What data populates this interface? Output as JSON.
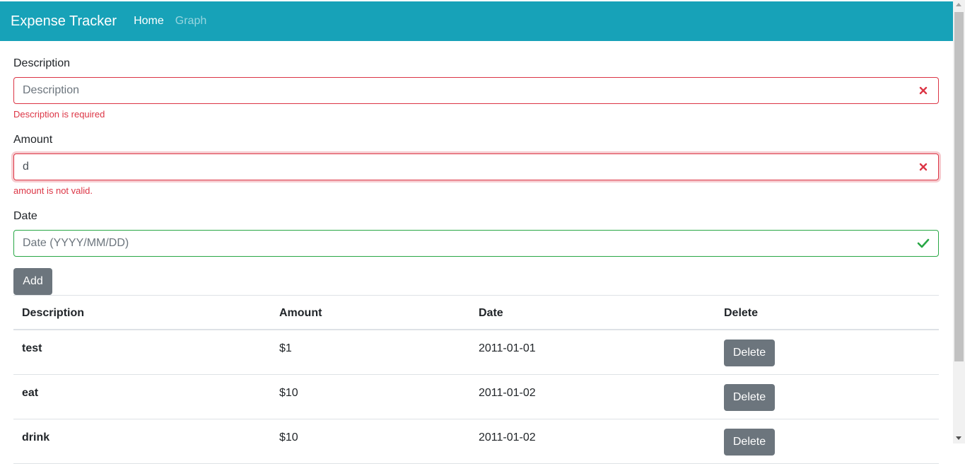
{
  "navbar": {
    "brand": "Expense Tracker",
    "links": [
      {
        "label": "Home",
        "active": true
      },
      {
        "label": "Graph",
        "active": false
      }
    ],
    "color": "#17a2b8"
  },
  "form": {
    "description": {
      "label": "Description",
      "placeholder": "Description",
      "value": "",
      "error": "Description is required",
      "status": "invalid",
      "icon": "times-icon"
    },
    "amount": {
      "label": "Amount",
      "placeholder": "",
      "value": "d",
      "error": "amount is not valid.",
      "status": "invalid",
      "icon": "times-icon"
    },
    "date": {
      "label": "Date",
      "placeholder": "Date (YYYY/MM/DD)",
      "value": "",
      "status": "valid",
      "icon": "check-icon"
    },
    "add_label": "Add"
  },
  "table": {
    "headers": [
      "Description",
      "Amount",
      "Date",
      "Delete"
    ],
    "rows": [
      {
        "description": "test",
        "amount": "$1",
        "date": "2011-01-01",
        "action": "Delete"
      },
      {
        "description": "eat",
        "amount": "$10",
        "date": "2011-01-02",
        "action": "Delete"
      },
      {
        "description": "drink",
        "amount": "$10",
        "date": "2011-01-02",
        "action": "Delete"
      }
    ]
  },
  "colors": {
    "invalid": "#dc3545",
    "valid": "#28a745",
    "button": "#6c757d"
  }
}
